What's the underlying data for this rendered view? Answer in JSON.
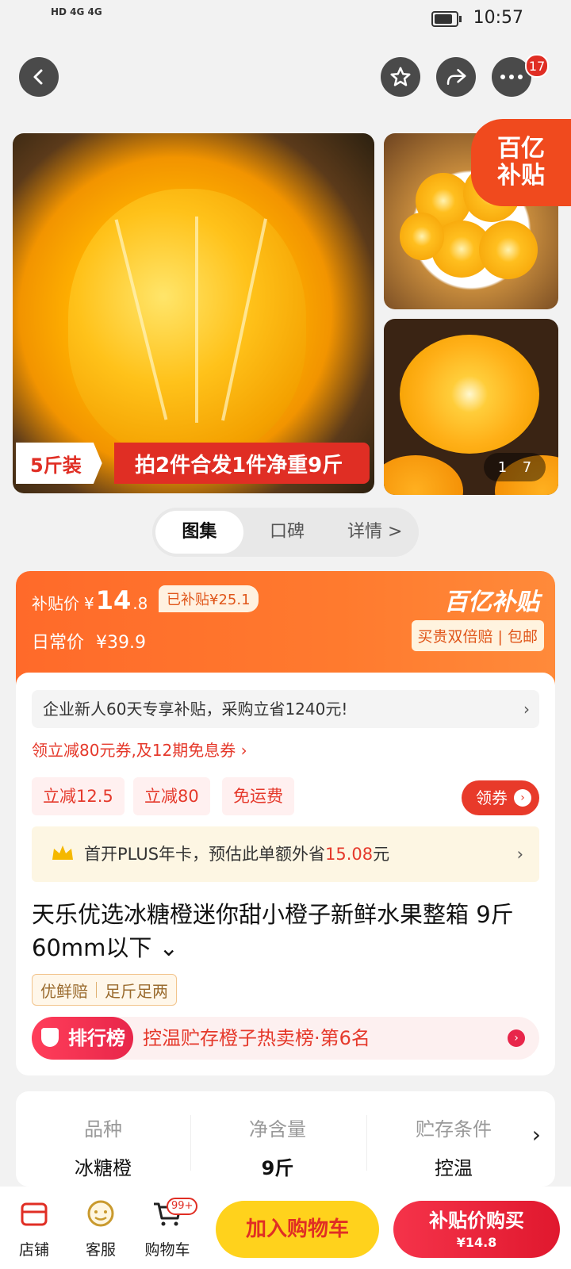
{
  "status_bar": {
    "left_text": "HD 4G 4G",
    "time": "10:57"
  },
  "nav": {
    "more_badge": "17"
  },
  "gallery": {
    "banner_left": "5斤装",
    "banner_right": "拍2件合发1件净重9斤",
    "corner_brand_top": "百亿",
    "corner_brand_bottom": "补贴",
    "pager_current": "1",
    "pager_total": "7"
  },
  "tabs": [
    {
      "label": "图集"
    },
    {
      "label": "口碑"
    },
    {
      "label": "详情 >"
    }
  ],
  "price": {
    "subsidy_label": "补贴价",
    "currency": "¥",
    "subsidy_price_int": "14",
    "subsidy_price_dec": ".8",
    "subsidized_tag": "已补贴¥25.1",
    "daily_label": "日常价",
    "daily_price": "¥39.9",
    "brand": "百亿补贴",
    "guarantee": "买贵双倍赔 | 包邮"
  },
  "promo": {
    "text": "企业新人60天专享补贴，采购立省1240元!",
    "chevron": "›"
  },
  "coupon_link": "领立减80元券,及12期免息券 ›",
  "chips": [
    "立减12.5",
    "立减80",
    "免运费"
  ],
  "get_coupon": "领券",
  "plus": {
    "text_a": "首开PLUS年卡，预估此单额外省",
    "amount": "15.08",
    "text_b": "元",
    "chevron": "›"
  },
  "title": "天乐优选冰糖橙迷你甜小橙子新鲜水果整箱 9斤60mm以下 ⌄",
  "service_tags": [
    "优鲜赔",
    "足斤足两"
  ],
  "rank": {
    "label": "排行榜",
    "text": "控温贮存橙子热卖榜·第6名"
  },
  "specs": [
    {
      "key": "品种",
      "value": "冰糖橙"
    },
    {
      "key": "净含量",
      "value": "9斤"
    },
    {
      "key": "贮存条件",
      "value": "控温"
    }
  ],
  "bottom": {
    "store": "店铺",
    "service": "客服",
    "cart": "购物车",
    "cart_badge": "99+",
    "add_cart": "加入购物车",
    "buy_line1": "补贴价购买",
    "buy_line2": "¥14.8"
  }
}
